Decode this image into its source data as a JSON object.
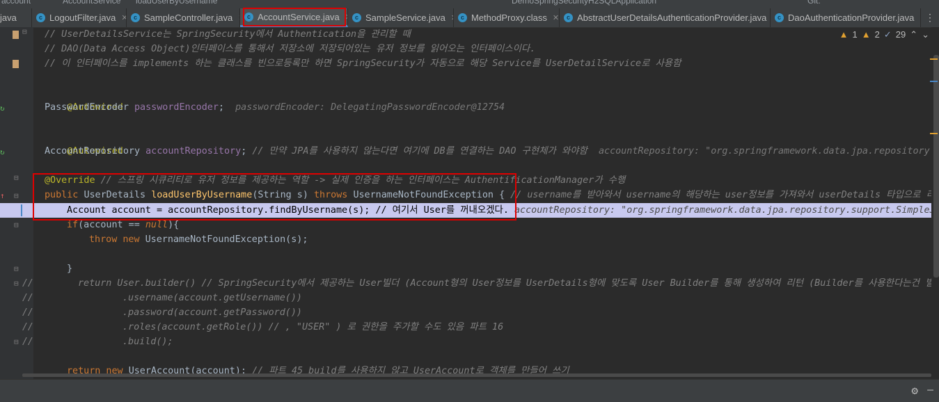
{
  "topbar": {
    "crumb1": "account",
    "crumb2": "AccountService",
    "crumb3": "loadUserByUsername",
    "run_config": "DemoSpringSecurityH2SQLApplication",
    "git": "Git:"
  },
  "tabs": [
    {
      "label": "java"
    },
    {
      "label": "LogoutFilter.java"
    },
    {
      "label": "SampleController.java"
    },
    {
      "label": "AccountService.java",
      "active": true
    },
    {
      "label": "SampleService.java"
    },
    {
      "label": "MethodProxy.class"
    },
    {
      "label": "AbstractUserDetailsAuthenticationProvider.java"
    },
    {
      "label": "DaoAuthenticationProvider.java"
    }
  ],
  "inspections": {
    "warnings_a": "1",
    "warnings_b": "2",
    "weak": "29"
  },
  "code": {
    "l1": "// UserDetailsService는 SpringSecurity에서 Authentication을 관리할 때",
    "l2": "// DAO(Data Access Object)인터페이스를 통해서 저장소에 저장되어있는 유저 정보를 읽어오는 인터페이스이다.",
    "l3": "// 이 인터페이스를 implements 하는 클래스를 빈으로등록만 하면 SpringSecurity가 자동으로 해당 Service를 UserDetailService로 사용함",
    "autowired": "@Autowired",
    "pe_type": "PasswordEncoder",
    "pe_field": "passwordEncoder",
    "pe_hint": "passwordEncoder: DelegatingPasswordEncoder@12754",
    "ar_type": "AccountRepository",
    "ar_field": "accountRepository",
    "ar_comment": "// 만약 JPA를 사용하지 않는다면 여기에 DB를 연결하는 DAO 구현체가 와야함",
    "ar_hint": "accountRepository: \"org.springframework.data.jpa.repository",
    "override": "@Override",
    "override_comment": "// 스프링 시큐리티로 유저 정보를 제공하는 역할 -> 실제 인증을 하는 인터페이스는 AuthentificationManager가 수행",
    "sig_public": "public",
    "sig_type": "UserDetails",
    "sig_method": "loadUserByUsername",
    "sig_params": "(String s)",
    "sig_throws": "throws",
    "sig_exception": "UsernameNotFoundException {",
    "sig_comment": "// username를 받아와서 username의 해당하는 user정보를 가져와서 userDetails 타입으로 리턴",
    "hl_code": "Account account = accountRepository.findByUsername(s);",
    "hl_comment": "// 여기서 User를 꺼내오겠다.",
    "hl_hint": "accountRepository: \"org.springframework.data.jpa.repository.support.SimpleJ",
    "if_kw": "if",
    "if_mid": "(account == ",
    "if_null": "null",
    "if_end": "){",
    "throw_kw": "throw new",
    "throw_rest": "UsernameNotFoundException(s);",
    "close": "}",
    "r1": "return User.builder() // SpringSecurity에서 제공하는 User빌더 (Account형의 User정보를 UserDetails형에 맞도록 User Builder를 통해 생성하여 리턴 (Builder를 사용한다는건 빌",
    "r2": ".username(account.getUsername())",
    "r3": ".password(account.getPassword())",
    "r4a": ".roles(account.getRole()) // , ",
    "r4s": "\"USER\"",
    "r4b": ") 로 권한을 주가할 수도 있음 파트 16",
    "r5": ".build();",
    "ret_kw": "return new",
    "ret_rest": "UserAccount(account);",
    "ret_comment": "// 파트 45 build를 사용하지 않고 UserAccount로 객체를 만들어 쓰기"
  },
  "gutter_slashes": "//",
  "colors": {
    "accent": "#4a88c7",
    "highlight": "#c8c9ef",
    "redbox": "#e00000",
    "background": "#2b2b2b"
  }
}
